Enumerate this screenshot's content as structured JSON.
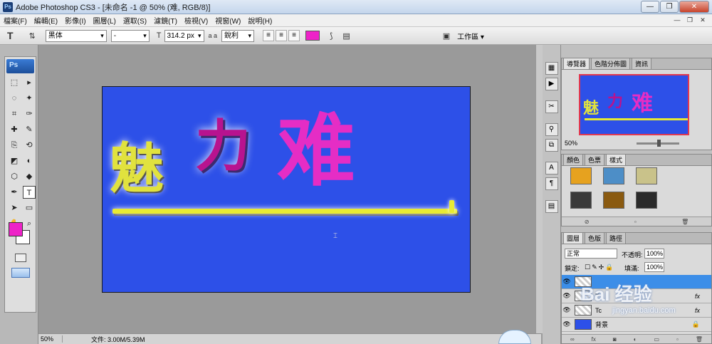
{
  "window": {
    "title": "Adobe Photoshop CS3 - [未命名 -1 @ 50% (难, RGB/8)]",
    "app_icon": "Ps",
    "buttons": {
      "minimize": "—",
      "restore": "❐",
      "close": "✕"
    }
  },
  "menu": {
    "items": [
      "檔案(F)",
      "編輯(E)",
      "影像(I)",
      "圖層(L)",
      "選取(S)",
      "濾鏡(T)",
      "檢視(V)",
      "視窗(W)",
      "說明(H)"
    ],
    "right_buttons": [
      "—",
      "❐",
      "✕"
    ]
  },
  "options_bar": {
    "tool_glyph": "T",
    "font_family": "黑体",
    "font_style": "-",
    "font_size": "314.2 px",
    "aa_label": "a a",
    "antialias": "銳利",
    "text_color": "#ee22c8",
    "workspace": "工作區 ▾"
  },
  "toolbox": {
    "logo": "Ps",
    "tools": [
      "⬚",
      "▸",
      "◌",
      "✦",
      "⌗",
      "✑",
      "✚",
      "✎",
      "⎘",
      "⟲",
      "◩",
      "◐",
      "⬡",
      "◆",
      "✒",
      "T",
      "➤",
      "▭",
      "✋",
      "⌕"
    ],
    "foreground": "#ee22c8",
    "background": "#ffffff"
  },
  "canvas": {
    "background": "#2d50e8",
    "glyphs": [
      "魅",
      "力",
      "难"
    ],
    "cursor": "⌶"
  },
  "status": {
    "zoom": "50%",
    "doc_info": "文件: 3.00M/5.39M"
  },
  "navigator": {
    "tabs": [
      "導覽器",
      "色階分佈圖",
      "資訊"
    ],
    "zoom": "50%",
    "preview_glyphs": [
      "魅",
      "力",
      "难"
    ]
  },
  "styles_panel": {
    "tabs": [
      "顏色",
      "色票",
      "樣式"
    ],
    "swatch_colors": [
      "#e6a21f",
      "#4d8ec7",
      "#c9c28a",
      "#3a3a3a",
      "#8a5a10",
      "#2a2a2a"
    ]
  },
  "layers_panel": {
    "tabs": [
      "圖層",
      "色版",
      "路徑"
    ],
    "blend_mode": "正常",
    "opacity_label": "不透明:",
    "opacity": "100%",
    "lock_label": "鎖定:",
    "fill_label": "填滿:",
    "fill": "100%",
    "layers": [
      {
        "name": "",
        "selected": true,
        "fx": ""
      },
      {
        "name": "T",
        "selected": false,
        "fx": "fx"
      },
      {
        "name": "Tc",
        "selected": false,
        "fx": "fx"
      },
      {
        "name": "背景",
        "selected": false,
        "fx": ""
      }
    ]
  },
  "watermark": {
    "text": "Bai 经验",
    "sub": "jingyan.baidu.com"
  }
}
